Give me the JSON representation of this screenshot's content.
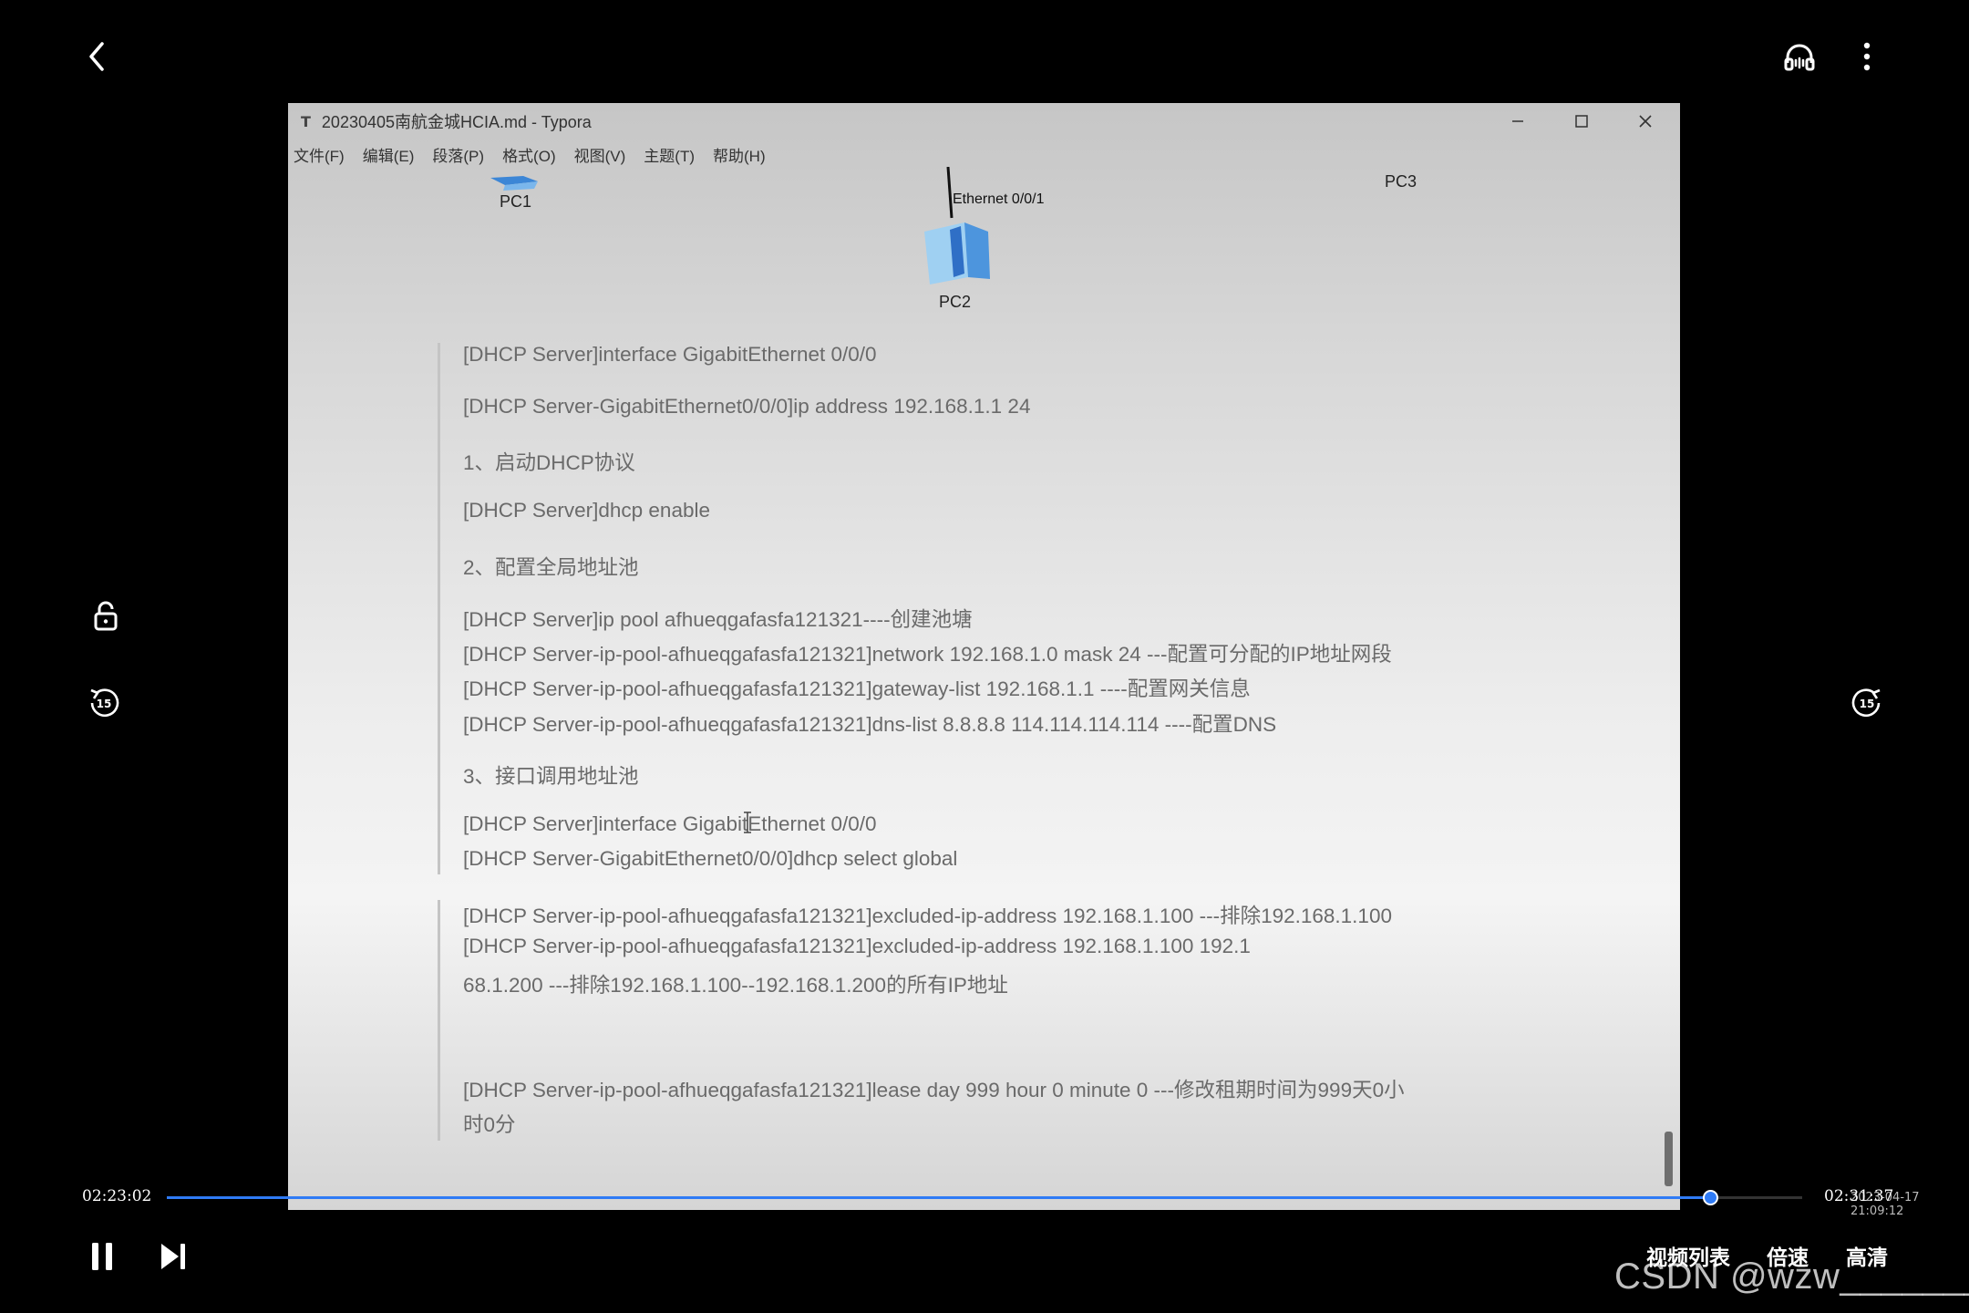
{
  "window": {
    "logo": "T",
    "title": "20230405南航金城HCIA.md - Typora"
  },
  "menu": [
    "文件(F)",
    "编辑(E)",
    "段落(P)",
    "格式(O)",
    "视图(V)",
    "主题(T)",
    "帮助(H)"
  ],
  "topology": {
    "pc1": "PC1",
    "pc2": "PC2",
    "pc3": "PC3",
    "ethernet": "Ethernet 0/0/1"
  },
  "doc_lines": [
    "[DHCP Server]interface GigabitEthernet 0/0/0",
    "[DHCP Server-GigabitEthernet0/0/0]ip address 192.168.1.1 24",
    "1、启动DHCP协议",
    "[DHCP Server]dhcp enable",
    "2、配置全局地址池",
    "[DHCP Server]ip pool afhueqgafasfa121321----创建池塘",
    "[DHCP Server-ip-pool-afhueqgafasfa121321]network 192.168.1.0 mask 24  ---配置可分配的IP地址网段",
    "[DHCP Server-ip-pool-afhueqgafasfa121321]gateway-list 192.168.1.1  ----配置网关信息",
    "[DHCP Server-ip-pool-afhueqgafasfa121321]dns-list 8.8.8.8 114.114.114.114  ----配置DNS",
    "3、接口调用地址池",
    "[DHCP Server]interface GigabitEthernet 0/0/0",
    "[DHCP Server-GigabitEthernet0/0/0]dhcp select global",
    "[DHCP Server-ip-pool-afhueqgafasfa121321]excluded-ip-address 192.168.1.100  ---排除192.168.1.100",
    "[DHCP Server-ip-pool-afhueqgafasfa121321]excluded-ip-address 192.168.1.100 192.1",
    "68.1.200   ---排除192.168.1.100--192.168.1.200的所有IP地址",
    "[DHCP Server-ip-pool-afhueqgafasfa121321]lease day 999 hour 0 minute 0   ---修改租期时间为999天0小",
    "时0分"
  ],
  "player": {
    "elapsed": "02:23:02",
    "total": "02:31:37",
    "timestamp": "2023-04-17 21:09:12",
    "progress": 0.9437,
    "list_label": "视频列表",
    "speed_label": "倍速",
    "quality_label": "高清",
    "skip_back_label": "15",
    "skip_fwd_label": "15",
    "icons": [
      "back-icon",
      "headset-icon",
      "more-icon",
      "lock-icon",
      "skip-back-15-icon",
      "skip-forward-15-icon",
      "pause-icon",
      "next-icon"
    ]
  },
  "watermark": "CSDN @wzw________"
}
